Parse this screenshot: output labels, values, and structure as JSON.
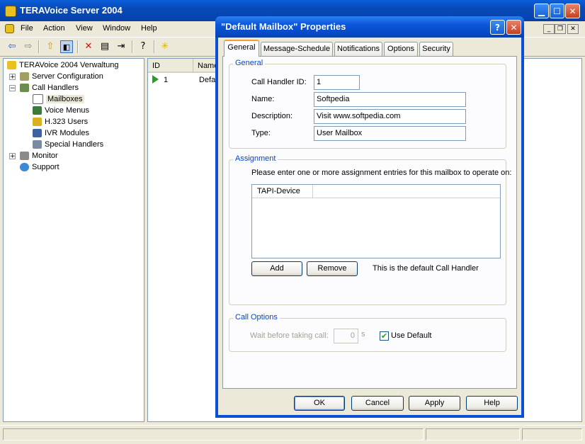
{
  "main": {
    "title": "TERAVoice Server 2004",
    "menu": [
      "File",
      "Action",
      "View",
      "Window",
      "Help"
    ],
    "icons": [
      "back-icon",
      "forward-icon",
      "up-folder-icon",
      "show-tree-icon",
      "delete-icon",
      "properties-icon",
      "export-icon",
      "help-icon",
      "new-icon"
    ]
  },
  "tree": {
    "root": "TERAVoice 2004 Verwaltung",
    "server_config": "Server Configuration",
    "call_handlers": "Call Handlers",
    "mailboxes": "Mailboxes",
    "voice_menus": "Voice Menus",
    "h323_users": "H.323 Users",
    "ivr_modules": "IVR Modules",
    "special_handlers": "Special Handlers",
    "monitor": "Monitor",
    "support": "Support"
  },
  "list": {
    "columns": [
      "ID",
      "Name"
    ],
    "row": {
      "id": "1",
      "name": "Defau"
    }
  },
  "dialog": {
    "title": "\"Default Mailbox\" Properties",
    "tabs": [
      "General",
      "Message-Schedule",
      "Notifications",
      "Options",
      "Security"
    ],
    "general_group": "General",
    "call_handler_id_label": "Call Handler ID:",
    "call_handler_id": "1",
    "name_label": "Name:",
    "name": "Softpedia",
    "description_label": "Description:",
    "description": "Visit www.softpedia.com",
    "type_label": "Type:",
    "type": "User Mailbox",
    "assignment_group": "Assignment",
    "assignment_prompt": "Please enter one or more assignment entries for this mailbox to operate on:",
    "assignment_column": "TAPI-Device",
    "add": "Add",
    "remove": "Remove",
    "default_note": "This is the default Call Handler",
    "call_options_group": "Call Options",
    "wait_label": "Wait before taking call:",
    "wait_value": "0",
    "wait_unit": "s",
    "use_default": "Use Default",
    "use_default_checked": true,
    "ok": "OK",
    "cancel": "Cancel",
    "apply": "Apply",
    "help": "Help"
  }
}
